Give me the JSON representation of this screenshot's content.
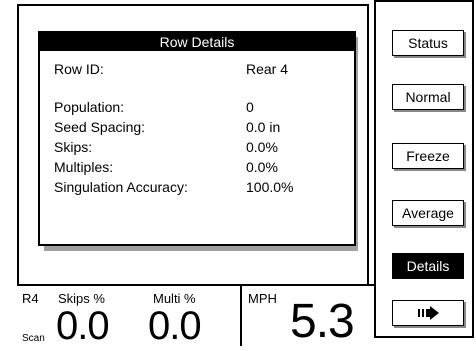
{
  "dialog": {
    "title": "Row Details",
    "rows": [
      {
        "label": "Row ID:",
        "value": "Rear 4"
      },
      {
        "label": "Population:",
        "value": "0"
      },
      {
        "label": "Seed Spacing:",
        "value": "0.0 in"
      },
      {
        "label": "Skips:",
        "value": "0.0%"
      },
      {
        "label": "Multiples:",
        "value": "0.0%"
      },
      {
        "label": "Singulation Accuracy:",
        "value": "100.0%"
      }
    ]
  },
  "side_menu": {
    "status": "Status",
    "normal": "Normal",
    "freeze": "Freeze",
    "average": "Average",
    "details": "Details",
    "next_icon": "next-page-arrow-icon"
  },
  "status_bar": {
    "row": "R4",
    "mode": "Scan",
    "skips_label": "Skips %",
    "skips_value": "0.0",
    "multi_label": "Multi %",
    "multi_value": "0.0",
    "mph_label": "MPH",
    "mph_value": "5.3"
  }
}
